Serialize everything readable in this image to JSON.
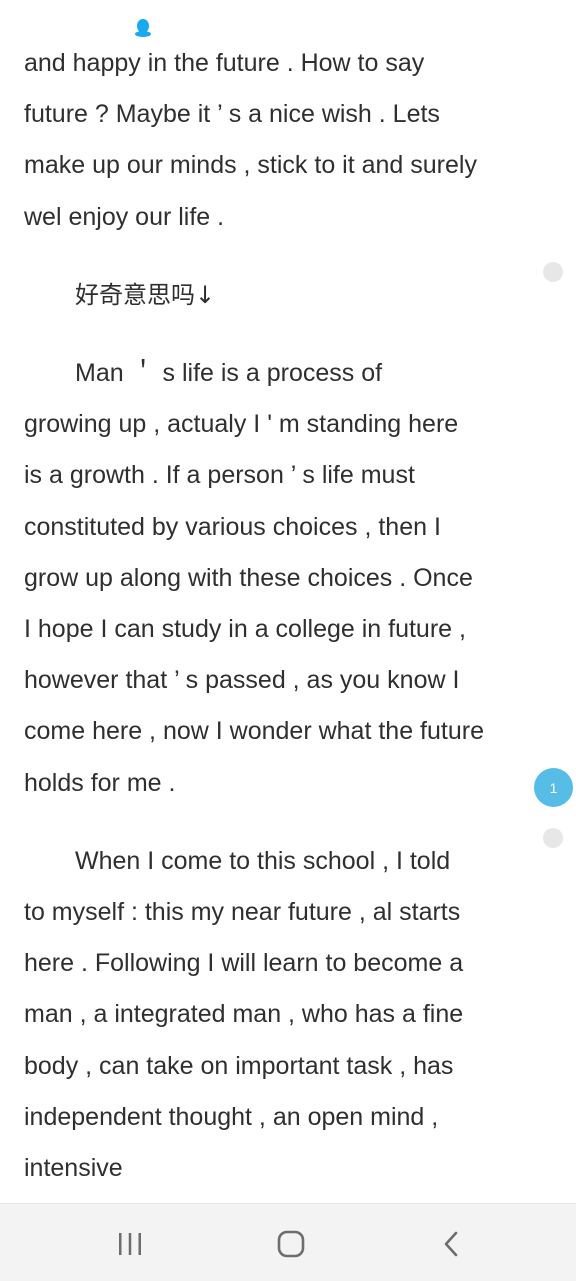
{
  "status_bar": {
    "notification_icon": "qq-penguin-icon",
    "notification_color": "#19a9ee"
  },
  "article": {
    "para1": [
      "and happy in the future . How to say",
      "future ? Maybe it ’ s a nice wish . Lets",
      "make up our minds , stick to it and surely",
      "wel enjoy our life ."
    ],
    "para2": [
      "好奇意思吗↓"
    ],
    "para3": [
      "Man ＇ s life is a process of",
      "growing up , actualy I ' m standing here",
      "is a growth . If a person ’ s life must",
      "constituted by various choices , then I",
      "grow up along with these choices . Once",
      "I hope I can study in a college in future ,",
      "however that ’ s passed , as you know I",
      "come here , now I wonder what the future",
      "holds for me ."
    ],
    "para4": [
      "When I come to this school , I told",
      "to myself : this my near future , al starts",
      "here . Following I will learn to become a",
      "man , a integrated man , who has a fine",
      "body , can take on important task , has",
      "independent thought , an open mind ,",
      "intensive"
    ]
  },
  "side_markers": {
    "comment_count": "1",
    "count_color": "#57bde6",
    "empty_color": "#e7e7e7"
  },
  "nav_bar": {
    "recent_apps_icon": "recent-apps-icon",
    "home_icon": "home-icon",
    "back_icon": "back-icon"
  }
}
